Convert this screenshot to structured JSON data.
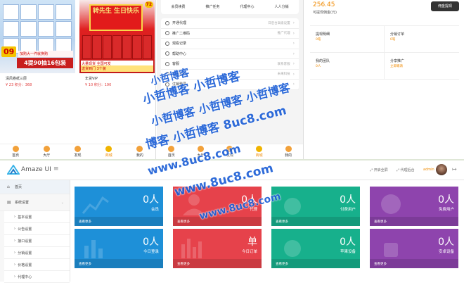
{
  "shop": {
    "products": [
      {
        "name": "清风卷纸三层",
        "price": "¥ 23 积分：368",
        "badge": "09",
        "tag": "加购大一件就换购",
        "tag2": "4提90抽16包装"
      },
      {
        "name": "年货VIP",
        "price": "¥ 10 积分：190",
        "gift": "转先生 生日快乐",
        "badge": "72",
        "tag": "大量现货  全国可发",
        "tag2": "送货到门 3个装"
      }
    ],
    "tabs": [
      "首页",
      "大厅",
      "发现",
      "商城",
      "我的"
    ],
    "active_tab": 3
  },
  "member": {
    "top_grid": [
      "会员续费",
      "推广任务",
      "代理中心",
      "人人分销"
    ],
    "menu": [
      {
        "label": "开通代理",
        "desc": "日后台高级设置"
      },
      {
        "label": "推广二维码",
        "desc": "推广代理"
      },
      {
        "label": "观看记录",
        "desc": ""
      },
      {
        "label": "帮助中心",
        "desc": ""
      },
      {
        "label": "客服",
        "desc": "联系客服"
      },
      {
        "label": "关于我们",
        "desc": "未来科技"
      },
      {
        "label": "注销登录",
        "desc": ""
      }
    ],
    "tabs": [
      "首页",
      "大厅",
      "发现",
      "商城",
      "我的"
    ],
    "active_tab": 3
  },
  "wallet": {
    "amount": "256.45",
    "amount_label": "可提现佣金(元)",
    "withdraw_button": "佣金提现",
    "cells": [
      {
        "title": "提现明细",
        "value": "0笔"
      },
      {
        "title": "分销订单",
        "value": "0笔"
      },
      {
        "title": "我的团队",
        "value": "0人"
      },
      {
        "title": "分享推广",
        "value": "立即邀请"
      }
    ]
  },
  "admin": {
    "logo": "Amaze UI",
    "header_links": [
      "开启全屏",
      "代理后台"
    ],
    "user": "admin",
    "sidebar": [
      {
        "label": "首页",
        "type": "home"
      },
      {
        "label": "系统设置",
        "type": "group"
      },
      {
        "label": "基本设置",
        "type": "sub"
      },
      {
        "label": "公告设置",
        "type": "sub"
      },
      {
        "label": "接口设置",
        "type": "sub"
      },
      {
        "label": "分销设置",
        "type": "sub"
      },
      {
        "label": "价格设置",
        "type": "sub"
      },
      {
        "label": "代理中心",
        "type": "sub"
      }
    ],
    "cards": [
      {
        "value": "0人",
        "label": "会员",
        "footer": "查看更多",
        "color": "#1e90d8"
      },
      {
        "value": "0人",
        "label": "代理",
        "footer": "查看更多",
        "color": "#e6424b"
      },
      {
        "value": "0人",
        "label": "付费用户",
        "footer": "查看更多",
        "color": "#17b08c"
      },
      {
        "value": "0人",
        "label": "免费用户",
        "footer": "查看更多",
        "color": "#8e44ad"
      },
      {
        "value": "0人",
        "label": "今日登录",
        "footer": "查看更多",
        "color": "#1e90d8"
      },
      {
        "value": "单",
        "label": "今日订单",
        "footer": "查看更多",
        "color": "#e6424b"
      },
      {
        "value": "0人",
        "label": "苹果设备",
        "footer": "查看更多",
        "color": "#17b08c"
      },
      {
        "value": "0人",
        "label": "安卓设备",
        "footer": "查看更多",
        "color": "#8e44ad"
      }
    ]
  },
  "watermark": {
    "line1": "小哲博客",
    "line2": "小哲博客 小哲博客",
    "line3": "小哲博客 小哲博客 小哲博客",
    "line4": "博客 小哲博客 8uc8.com",
    "line5": "www.8uc8.com",
    "line6": "www.8uc8.com",
    "line7": "www.8uc8.com",
    "color": "#1d5fd6"
  }
}
